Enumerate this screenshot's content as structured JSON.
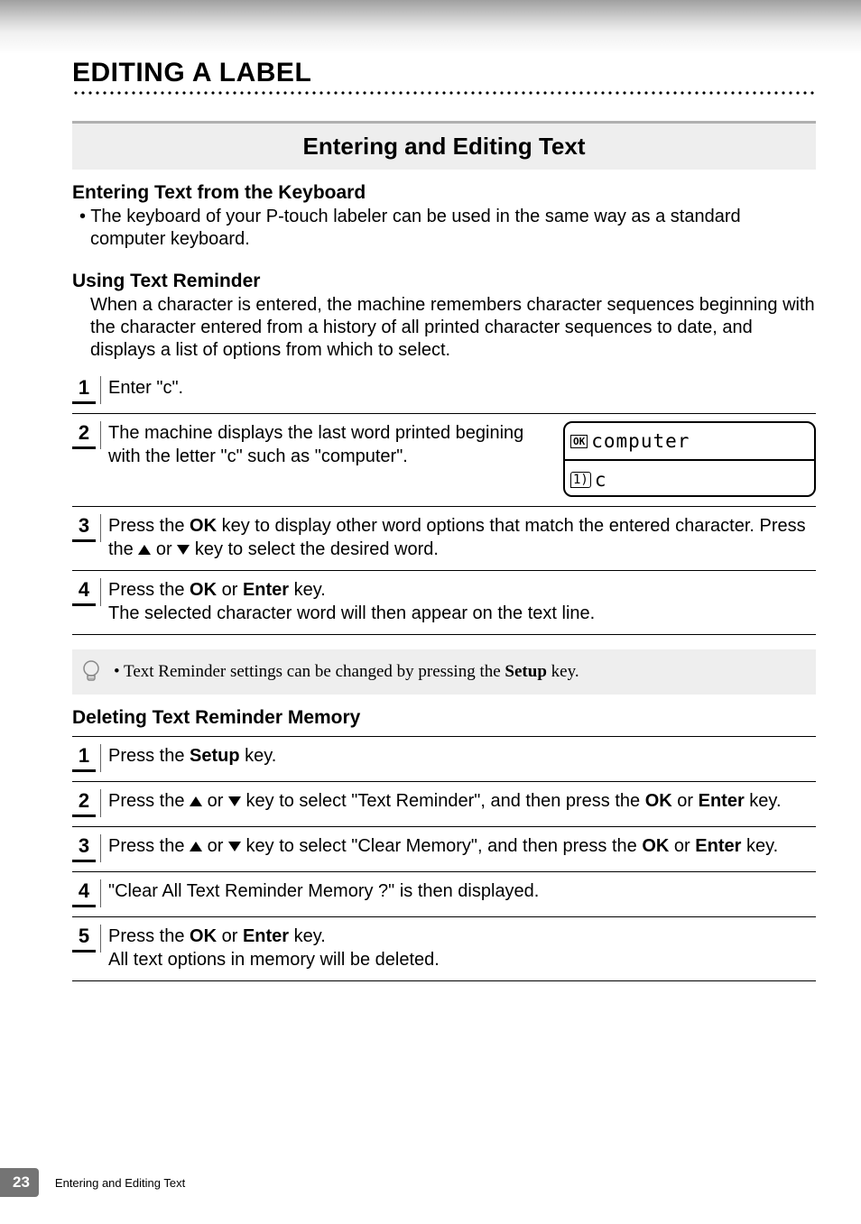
{
  "chapter": {
    "title": "EDITING A LABEL"
  },
  "section": {
    "title": "Entering and Editing Text"
  },
  "sub1": {
    "heading": "Entering Text from the Keyboard",
    "bullet": "•  The keyboard of your P-touch labeler can be used in the same way as a standard computer keyboard."
  },
  "sub2": {
    "heading": "Using Text Reminder",
    "intro": "When a character is entered, the machine remembers character sequences beginning with the character entered from a history of all printed character sequences to date, and displays a list of options from which to select."
  },
  "steps_a": {
    "s1": {
      "num": "1",
      "text": "Enter \"c\"."
    },
    "s2": {
      "num": "2",
      "text": "The machine displays the last word printed begining with the letter \"c\" such as \"computer\".",
      "lcd_ok": "OK",
      "lcd_word": "computer",
      "lcd_line2_icon": "1)",
      "lcd_line2_text": "c"
    },
    "s3": {
      "num": "3",
      "pre": "Press the ",
      "b1": "OK",
      "post1": " key to display other word options that match the entered character. Press the ",
      "post2": " or ",
      "post3": " key to select the desired word."
    },
    "s4": {
      "num": "4",
      "pre": "Press the ",
      "b1": "OK",
      "mid": " or ",
      "b2": "Enter",
      "post": " key.",
      "line2": "The selected character word will then appear on the text line."
    }
  },
  "note": {
    "pre": "• Text Reminder settings can be changed by pressing the ",
    "b": "Setup",
    "post": " key."
  },
  "sub3": {
    "heading": "Deleting Text Reminder Memory"
  },
  "steps_b": {
    "s1": {
      "num": "1",
      "pre": "Press the ",
      "b": "Setup",
      "post": " key."
    },
    "s2": {
      "num": "2",
      "pre": "Press the ",
      "mid1": " or ",
      "mid2": " key to select \"Text Reminder\", and then press the ",
      "b1": "OK",
      "mid3": " or ",
      "b2": "Enter",
      "post": " key."
    },
    "s3": {
      "num": "3",
      "pre": "Press the ",
      "mid1": " or ",
      "mid2": " key to select \"Clear Memory\", and then press the ",
      "b1": "OK",
      "mid3": " or ",
      "b2": "Enter",
      "post": " key."
    },
    "s4": {
      "num": "4",
      "text": "\"Clear All Text Reminder Memory ?\" is then displayed."
    },
    "s5": {
      "num": "5",
      "pre": "Press the ",
      "b1": "OK",
      "mid": " or ",
      "b2": "Enter",
      "post": " key.",
      "line2": "All text options in memory will be deleted."
    }
  },
  "footer": {
    "page": "23",
    "text": "Entering and Editing Text"
  }
}
